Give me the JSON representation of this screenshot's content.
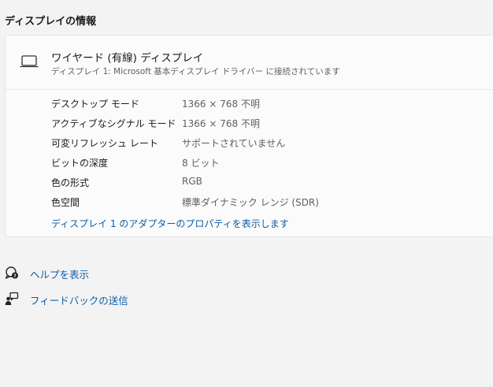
{
  "section_title": "ディスプレイの情報",
  "display": {
    "name": "ワイヤード (有線) ディスプレイ",
    "subtitle": "ディスプレイ 1: Microsoft 基本ディスプレイ ドライバー に接続されています",
    "icon": "laptop-icon"
  },
  "properties": [
    {
      "label": "デスクトップ モード",
      "value": "1366 × 768 不明"
    },
    {
      "label": "アクティブなシグナル モード",
      "value": "1366 × 768 不明"
    },
    {
      "label": "可変リフレッシュ レート",
      "value": "サポートされていません"
    },
    {
      "label": "ビットの深度",
      "value": "8 ビット"
    },
    {
      "label": "色の形式",
      "value": "RGB"
    },
    {
      "label": "色空間",
      "value": "標準ダイナミック レンジ (SDR)"
    }
  ],
  "adapter_link": "ディスプレイ 1 のアダプターのプロパティを表示します",
  "help_links": [
    {
      "label": "ヘルプを表示",
      "icon": "help-chat-icon"
    },
    {
      "label": "フィードバックの送信",
      "icon": "feedback-icon"
    }
  ],
  "colors": {
    "background": "#f3f3f3",
    "card": "#fbfbfb",
    "link": "#0e5ca8",
    "secondary_text": "#5f5f5f"
  }
}
